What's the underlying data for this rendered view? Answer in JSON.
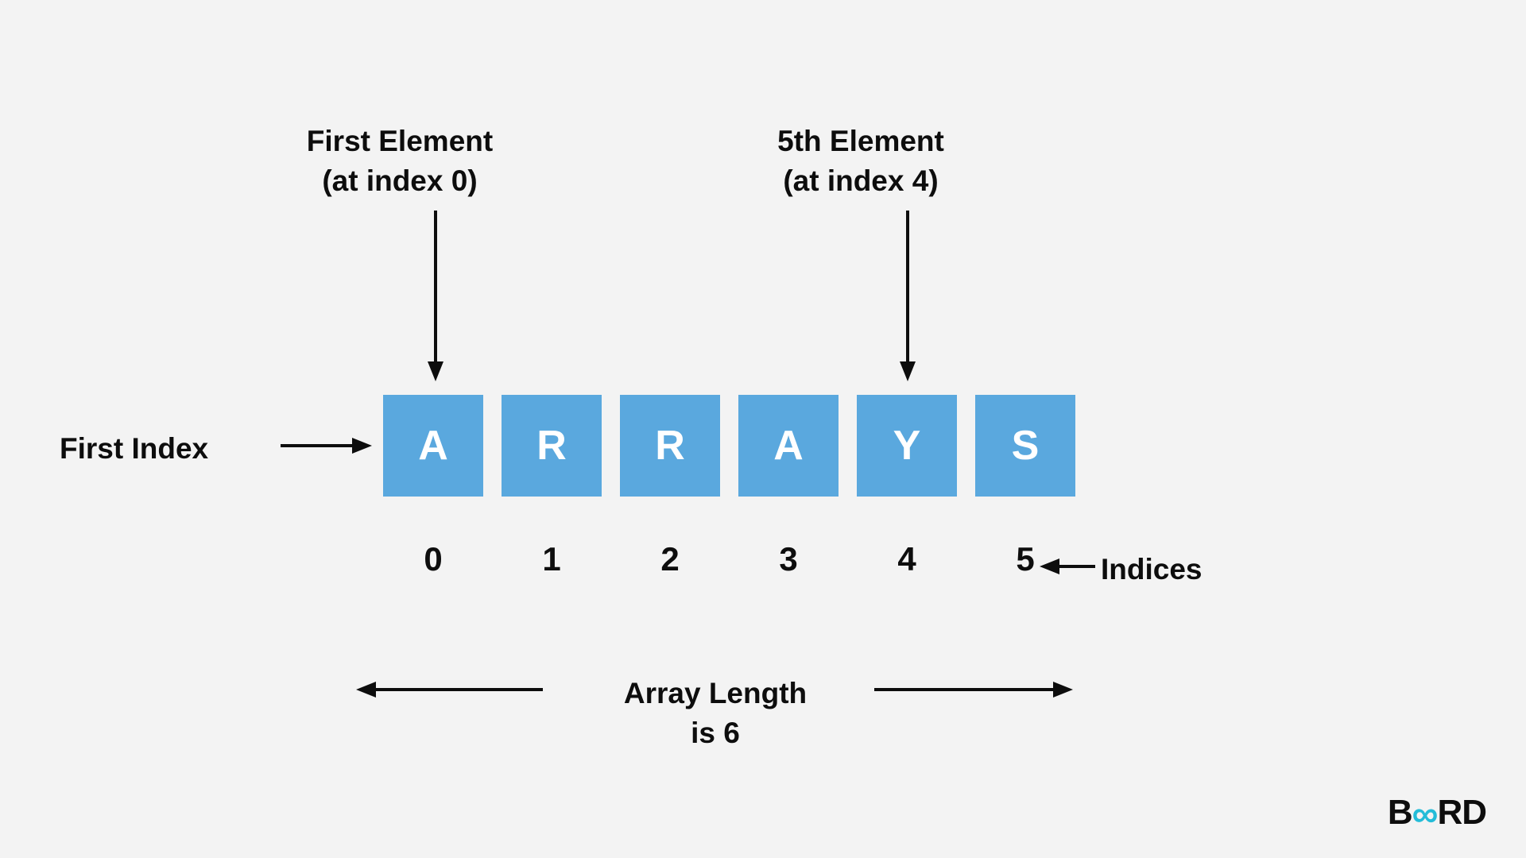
{
  "labels": {
    "first_element_l1": "First Element",
    "first_element_l2": "(at index 0)",
    "fifth_element_l1": "5th Element",
    "fifth_element_l2": "(at index 4)",
    "first_index": "First Index",
    "indices": "Indices",
    "array_length_l1": "Array Length",
    "array_length_l2": "is 6"
  },
  "array": {
    "cells": [
      "A",
      "R",
      "R",
      "A",
      "Y",
      "S"
    ],
    "indices": [
      "0",
      "1",
      "2",
      "3",
      "4",
      "5"
    ],
    "length": 6
  },
  "colors": {
    "cell_bg": "#5aa8de",
    "cell_fg": "#ffffff",
    "page_bg": "#f3f3f3",
    "text": "#0d0d0d",
    "accent": "#23bcd8"
  },
  "logo": {
    "b": "B",
    "inf": "∞",
    "rd": "RD"
  }
}
